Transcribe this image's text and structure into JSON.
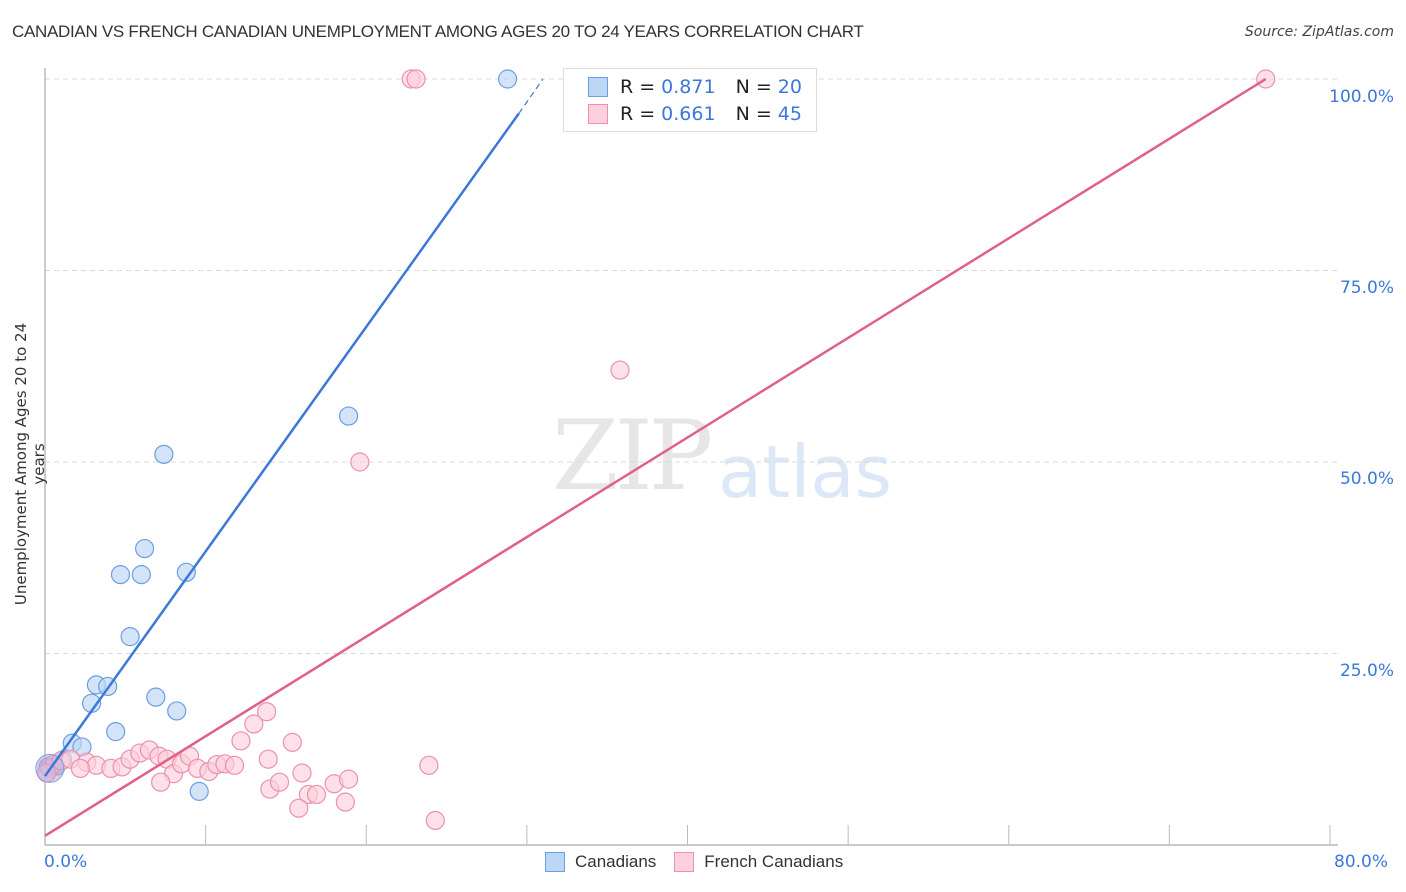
{
  "header": {
    "title": "CANADIAN VS FRENCH CANADIAN UNEMPLOYMENT AMONG AGES 20 TO 24 YEARS CORRELATION CHART",
    "source": "Source: ZipAtlas.com"
  },
  "watermark": {
    "part1": "ZIP",
    "part2": "atlas"
  },
  "legend": {
    "rows": [
      {
        "r_label": "R =",
        "r_value": "0.871",
        "n_label": "N =",
        "n_value": "20",
        "color": "#a8c8f0",
        "border": "#6a9ee0"
      },
      {
        "r_label": "R =",
        "r_value": "0.661",
        "n_label": "N =",
        "n_value": "45",
        "color": "#f9c0d0",
        "border": "#ec90ac"
      }
    ]
  },
  "bottom_legend": [
    {
      "label": "Canadians",
      "color": "#bcd6f5",
      "border": "#6a9ee0"
    },
    {
      "label": "French Canadians",
      "color": "#fcd0dc",
      "border": "#ec90ac"
    }
  ],
  "chart_data": {
    "type": "scatter",
    "title": "CANADIAN VS FRENCH CANADIAN UNEMPLOYMENT AMONG AGES 20 TO 24 YEARS CORRELATION CHART",
    "xlabel": "",
    "ylabel": "Unemployment Among Ages 20 to 24 years",
    "xlim": [
      0,
      80
    ],
    "ylim": [
      0,
      100
    ],
    "x_tick_labels": [
      "0.0%",
      "80.0%"
    ],
    "y_ticks": [
      25,
      50,
      75,
      100
    ],
    "y_tick_labels": [
      "25.0%",
      "50.0%",
      "75.0%",
      "100.0%"
    ],
    "grid": true,
    "legend_position": "top-center",
    "series": [
      {
        "name": "Canadians",
        "color": "#3b78d8",
        "fill": "#bcd6f5",
        "R": 0.871,
        "N": 20,
        "trend": {
          "x": [
            0,
            29.5
          ],
          "y": [
            9.0,
            95.5
          ],
          "dashed_extension_to": [
            31,
            100
          ]
        },
        "points": [
          [
            28.8,
            100
          ],
          [
            18.9,
            56.0
          ],
          [
            7.4,
            51.0
          ],
          [
            6.2,
            38.7
          ],
          [
            4.7,
            35.3
          ],
          [
            6.0,
            35.3
          ],
          [
            8.8,
            35.6
          ],
          [
            5.3,
            27.2
          ],
          [
            3.2,
            20.9
          ],
          [
            3.9,
            20.7
          ],
          [
            6.9,
            19.3
          ],
          [
            8.2,
            17.5
          ],
          [
            2.9,
            18.5
          ],
          [
            4.4,
            14.8
          ],
          [
            1.7,
            13.3
          ],
          [
            2.3,
            12.8
          ],
          [
            9.6,
            7.0
          ],
          [
            0.7,
            10.3
          ],
          [
            0.2,
            10.2
          ],
          [
            1.1,
            11.1
          ]
        ]
      },
      {
        "name": "French Canadians",
        "color": "#e0608a",
        "fill": "#fcd0dc",
        "R": 0.661,
        "N": 45,
        "trend": {
          "x": [
            0,
            76.0
          ],
          "y": [
            1.2,
            100
          ]
        },
        "points": [
          [
            22.8,
            100
          ],
          [
            23.1,
            100
          ],
          [
            76.0,
            100
          ],
          [
            35.8,
            62.0
          ],
          [
            19.6,
            50.0
          ],
          [
            0.3,
            10.0
          ],
          [
            0.6,
            10.6
          ],
          [
            1.0,
            11.0
          ],
          [
            1.6,
            11.2
          ],
          [
            2.6,
            10.8
          ],
          [
            3.2,
            10.4
          ],
          [
            4.1,
            10.0
          ],
          [
            4.8,
            10.2
          ],
          [
            5.3,
            11.2
          ],
          [
            5.9,
            12.0
          ],
          [
            6.5,
            12.4
          ],
          [
            7.1,
            11.6
          ],
          [
            7.6,
            11.2
          ],
          [
            8.0,
            9.3
          ],
          [
            8.5,
            10.6
          ],
          [
            9.0,
            11.6
          ],
          [
            9.5,
            10.0
          ],
          [
            10.2,
            9.6
          ],
          [
            10.7,
            10.5
          ],
          [
            11.2,
            10.6
          ],
          [
            11.8,
            10.4
          ],
          [
            12.2,
            13.6
          ],
          [
            13.0,
            15.8
          ],
          [
            13.8,
            17.4
          ],
          [
            7.2,
            8.2
          ],
          [
            14.0,
            7.3
          ],
          [
            14.6,
            8.2
          ],
          [
            15.4,
            13.4
          ],
          [
            16.0,
            9.4
          ],
          [
            16.4,
            6.6
          ],
          [
            16.9,
            6.6
          ],
          [
            18.0,
            8.0
          ],
          [
            18.7,
            5.6
          ],
          [
            18.9,
            8.6
          ],
          [
            15.8,
            4.8
          ],
          [
            23.9,
            10.4
          ],
          [
            24.3,
            3.2
          ],
          [
            2.2,
            10.0
          ],
          [
            0.1,
            9.4
          ],
          [
            13.9,
            11.2
          ]
        ]
      }
    ]
  }
}
